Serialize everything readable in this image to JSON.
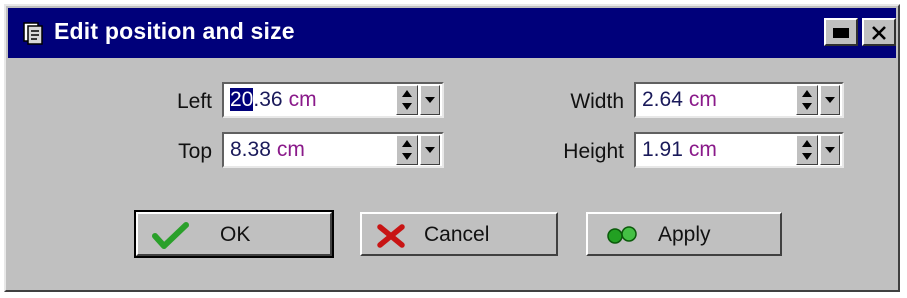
{
  "window": {
    "title": "Edit position and size",
    "icons": {
      "app": "app-icon",
      "minimize": "minimize-icon",
      "close": "close-icon"
    }
  },
  "fields": {
    "left": {
      "label": "Left",
      "value_selected": "20",
      "value_rest": ".36",
      "unit": "cm"
    },
    "top": {
      "label": "Top",
      "value_selected": "",
      "value_rest": "8.38",
      "unit": "cm"
    },
    "width": {
      "label": "Width",
      "value_selected": "",
      "value_rest": "2.64",
      "unit": "cm"
    },
    "height": {
      "label": "Height",
      "value_selected": "",
      "value_rest": "1.91",
      "unit": "cm"
    }
  },
  "buttons": {
    "ok": {
      "label": "OK",
      "icon": "checkmark-icon"
    },
    "cancel": {
      "label": "Cancel",
      "icon": "x-mark-icon"
    },
    "apply": {
      "label": "Apply",
      "icon": "apply-links-icon"
    }
  },
  "colors": {
    "titlebar": "#00007a",
    "unit_text": "#8a1a8a",
    "check": "#2aa02a",
    "cross": "#c81414",
    "apply": "#22a022"
  }
}
